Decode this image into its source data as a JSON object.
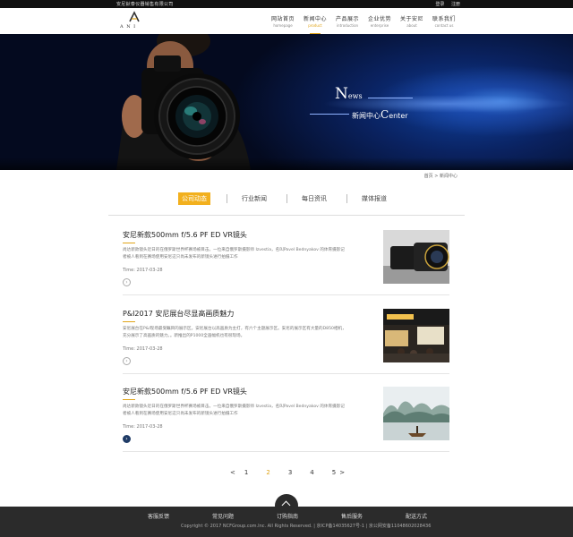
{
  "topbar": {
    "company": "安尼鈥泰仪器销售有限公司",
    "login": "登录",
    "register": "注册"
  },
  "logo": {
    "name": "A N I"
  },
  "nav": [
    {
      "zh": "网站首页",
      "en": "homepage"
    },
    {
      "zh": "新闻中心",
      "en": "product"
    },
    {
      "zh": "产品展示",
      "en": "introduction"
    },
    {
      "zh": "企业优势",
      "en": "enterprise"
    },
    {
      "zh": "关于安尼",
      "en": "about"
    },
    {
      "zh": "联系我们",
      "en": "contact us"
    }
  ],
  "banner": {
    "news_cap": "N",
    "news_rest": "ews",
    "center_zh": "新闻中心",
    "center_cap": "C",
    "center_rest": "enter"
  },
  "breadcrumb": "首页 > 新闻中心",
  "tabs": [
    "公司动态",
    "行业新闻",
    "每日资讯",
    "媒体报道"
  ],
  "news": [
    {
      "title": "安尼新款500mm f/5.6 PF ED VR镜头",
      "summary": "尚达新款镜头近日的在俄罗斯世界杯赛场被目击。一位来自俄罗斯摄影师 Izvestia，名叫Pavel Bednyakov 的体育摄影记者被人看到在赛场使用安尼这只尚未发布的新镜头进行拍摄工作",
      "time": "Time: 2017-03-28"
    },
    {
      "title": "P&I2017 安尼展台尽显高画质魅力",
      "summary": "安尼展台在P&I现场最受瞩目的展示区。安尼展台以高画质为主打，有六个主题展示区。安尼的展示区有大量的D850相机，充分展示了高画质的魅力。。新推出的P1000全画幅机也有很现场。",
      "time": "Time: 2017-03-28"
    },
    {
      "title": "安尼新款500mm f/5.6 PF ED VR镜头",
      "summary": "尚达新款镜头近日的在俄罗斯世界杯赛场被目击。一位来自俄罗斯摄影师 Izvestia，名叫Pavel Bednyakov 的体育摄影记者被人看到在赛场使用安尼这只尚未发布的新镜头进行拍摄工作",
      "time": "Time: 2017-03-28"
    }
  ],
  "pager": {
    "prev": "<",
    "pages": [
      "1",
      "2",
      "3",
      "4",
      "5"
    ],
    "next": ">",
    "current": "2"
  },
  "footer": {
    "links": [
      "客服反馈",
      "常见问题",
      "订购指南",
      "售后服务",
      "配送方式"
    ],
    "copyright": "Copyright © 2017 NCFGroup.com.Inc. All Rights Reserved. | 京ICP备14035627号-1 | 京公网安备11048602028436"
  },
  "colors": {
    "accent": "#e0a419",
    "tab_active": "#f2b01e",
    "footer": "#2b2b2b",
    "banner_blue": "#0e3f9a"
  }
}
